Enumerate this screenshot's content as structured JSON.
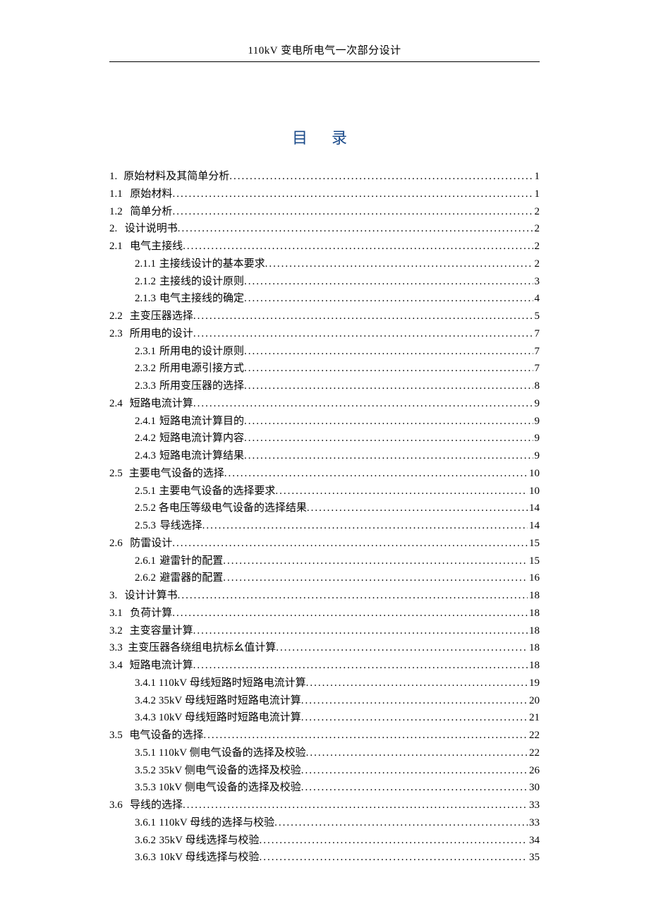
{
  "header_title": "110kV 变电所电气一次部分设计",
  "toc_title": "目 录",
  "entries": [
    {
      "level": 1,
      "num": "1.",
      "label": "原始材料及其简单分析",
      "page": "1"
    },
    {
      "level": 1,
      "num": "1.1",
      "label": "原始材料",
      "page": "1"
    },
    {
      "level": 1,
      "num": "1.2",
      "label": "简单分析",
      "page": "2"
    },
    {
      "level": 1,
      "num": "2.",
      "label": "设计说明书",
      "page": "2"
    },
    {
      "level": 1,
      "num": "2.1",
      "label": "电气主接线",
      "page": "2"
    },
    {
      "level": 2,
      "num": "2.1.1",
      "label": "主接线设计的基本要求",
      "page": "2"
    },
    {
      "level": 2,
      "num": "2.1.2",
      "label": "主接线的设计原则",
      "page": "3"
    },
    {
      "level": 2,
      "num": "2.1.3",
      "label": "电气主接线的确定",
      "page": "4"
    },
    {
      "level": 1,
      "num": "2.2",
      "label": "主变压器选择",
      "page": "5"
    },
    {
      "level": 1,
      "num": "2.3",
      "label": "所用电的设计",
      "page": "7"
    },
    {
      "level": 2,
      "num": "2.3.1",
      "label": "所用电的设计原则",
      "page": "7"
    },
    {
      "level": 2,
      "num": "2.3.2",
      "label": "所用电源引接方式",
      "page": "7"
    },
    {
      "level": 2,
      "num": "2.3.3",
      "label": "所用变压器的选择",
      "page": "8"
    },
    {
      "level": 1,
      "num": "2.4",
      "label": "短路电流计算",
      "page": "9"
    },
    {
      "level": 2,
      "num": "2.4.1",
      "label": "短路电流计算目的",
      "page": "9"
    },
    {
      "level": 2,
      "num": "2.4.2",
      "label": "短路电流计算内容",
      "page": "9"
    },
    {
      "level": 2,
      "num": "2.4.3",
      "label": "短路电流计算结果",
      "page": "9"
    },
    {
      "level": 1,
      "num": "2.5",
      "label": "主要电气设备的选择",
      "page": "10"
    },
    {
      "level": 2,
      "num": "2.5.1",
      "label": "主要电气设备的选择要求",
      "page": "10"
    },
    {
      "level": 2,
      "num": "2.5.2",
      "label": "各电压等级电气设备的选择结果",
      "page": "14"
    },
    {
      "level": 2,
      "num": "2.5.3",
      "label": "导线选择",
      "page": "14"
    },
    {
      "level": 1,
      "num": "2.6",
      "label": "防雷设计",
      "page": "15"
    },
    {
      "level": 2,
      "num": "2.6.1",
      "label": "避雷针的配置 ",
      "page": "15"
    },
    {
      "level": 2,
      "num": "2.6.2",
      "label": "避雷器的配置 ",
      "page": "16"
    },
    {
      "level": 1,
      "num": "3.",
      "label": "设计计算书",
      "page": "18"
    },
    {
      "level": 1,
      "num": "3.1",
      "label": "负荷计算",
      "page": "18"
    },
    {
      "level": 1,
      "num": "3.2",
      "label": "主变容量计算",
      "page": "18"
    },
    {
      "level": 1,
      "num": "3.3",
      "label": "主变压器各绕组电抗标幺值计算",
      "page": "18"
    },
    {
      "level": 1,
      "num": "3.4",
      "label": "短路电流计算",
      "page": "18"
    },
    {
      "level": 2,
      "num": "3.4.1",
      "label": "110kV 母线短路时短路电流计算",
      "page": "19"
    },
    {
      "level": 2,
      "num": "3.4.2",
      "label": "35kV 母线短路时短路电流计算",
      "page": "20"
    },
    {
      "level": 2,
      "num": "3.4.3",
      "label": "10kV 母线短路时短路电流计算",
      "page": "21"
    },
    {
      "level": 1,
      "num": "3.5",
      "label": "电气设备的选择",
      "page": "22"
    },
    {
      "level": 2,
      "num": "3.5.1",
      "label": "110kV 侧电气设备的选择及校验",
      "page": "22"
    },
    {
      "level": 2,
      "num": "3.5.2",
      "label": "35kV 侧电气设备的选择及校验",
      "page": "26"
    },
    {
      "level": 2,
      "num": "3.5.3",
      "label": "10kV 侧电气设备的选择及校验",
      "page": "30"
    },
    {
      "level": 1,
      "num": "3.6",
      "label": "导线的选择",
      "page": "33"
    },
    {
      "level": 2,
      "num": "3.6.1",
      "label": "110kV 母线的选择与校验",
      "page": "33"
    },
    {
      "level": 2,
      "num": "3.6.2",
      "label": "35kV 母线选择与校验",
      "page": "34"
    },
    {
      "level": 2,
      "num": "3.6.3",
      "label": "10kV 母线选择与校验",
      "page": "35"
    }
  ]
}
